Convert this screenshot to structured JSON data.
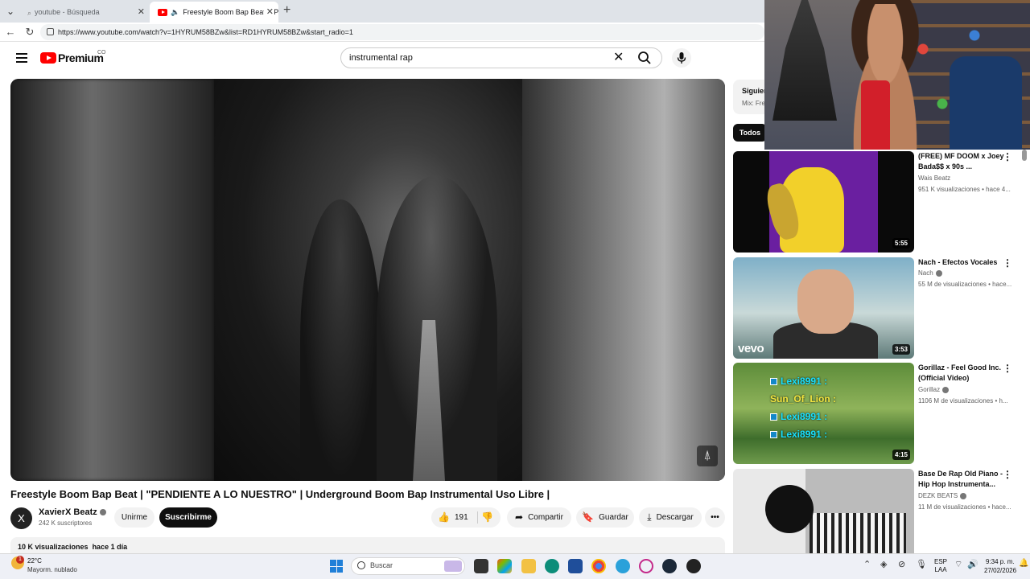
{
  "browser": {
    "tabs": [
      {
        "label": "youtube - Búsqueda",
        "active": false
      },
      {
        "label": "Freestyle Boom Bap Beat | \"PE",
        "active": true
      }
    ],
    "url": "https://www.youtube.com/watch?v=1HYRUM58BZw&list=RD1HYRUM58BZw&start_radio=1"
  },
  "masthead": {
    "logo_text": "Premium",
    "country": "CO",
    "search_query": "instrumental rap"
  },
  "video": {
    "title": "Freestyle Boom Bap Beat | \"PENDIENTE A LO NUESTRO\" | Underground Boom Bap Instrumental Uso Libre |",
    "channel_initial": "X",
    "channel_name": "XavierX Beatz",
    "subscribers": "242 K suscriptores",
    "join_label": "Unirme",
    "subscribe_label": "Suscribirme",
    "likes": "191",
    "share_label": "Compartir",
    "save_label": "Guardar",
    "download_label": "Descargar",
    "views": "10 K visualizaciones",
    "age": "hace 1 día"
  },
  "queue": {
    "title": "Siguiente",
    "subtitle": "Mix: Fre"
  },
  "chips": {
    "all": "Todos"
  },
  "recommendations": [
    {
      "title": "(FREE) MF DOOM x Joey Bada$$ x 90s ...",
      "channel": "Wais Beatz",
      "meta": "951 K visualizaciones • hace 4...",
      "duration": "5:55",
      "verified": false
    },
    {
      "title": "Nach - Efectos Vocales",
      "channel": "Nach",
      "meta": "55 M de visualizaciones • hace...",
      "duration": "3:53",
      "verified": true
    },
    {
      "title": "Gorillaz - Feel Good Inc. (Official Video)",
      "channel": "Gorillaz",
      "meta": "1106 M de visualizaciones • h...",
      "duration": "4:15",
      "verified": true
    },
    {
      "title": "Base De Rap Old Piano - Hip Hop Instrumenta...",
      "channel": "DEZK BEATS",
      "meta": "11 M de visualizaciones • hace...",
      "duration": "",
      "verified": true
    }
  ],
  "thumb_overlays": {
    "vevo": "vevo",
    "chat": [
      {
        "user": "Lexi8991",
        "sep": ":"
      },
      {
        "user": "Sun_Of_Lion",
        "sep": ":"
      },
      {
        "user": "Lexi8991",
        "sep": ":"
      },
      {
        "user": "Lexi8991",
        "sep": ":"
      }
    ]
  },
  "taskbar": {
    "weather_badge": "1",
    "temperature": "22°C",
    "weather_desc": "Mayorm. nublado",
    "search_placeholder": "Buscar",
    "lang_1": "ESP",
    "lang_2": "LAA",
    "time": "9:34 p. m.",
    "date": "27/02/2026"
  },
  "colors": {
    "youtube_red": "#ff0000",
    "text_primary": "#0f0f0f",
    "text_secondary": "#606060"
  }
}
